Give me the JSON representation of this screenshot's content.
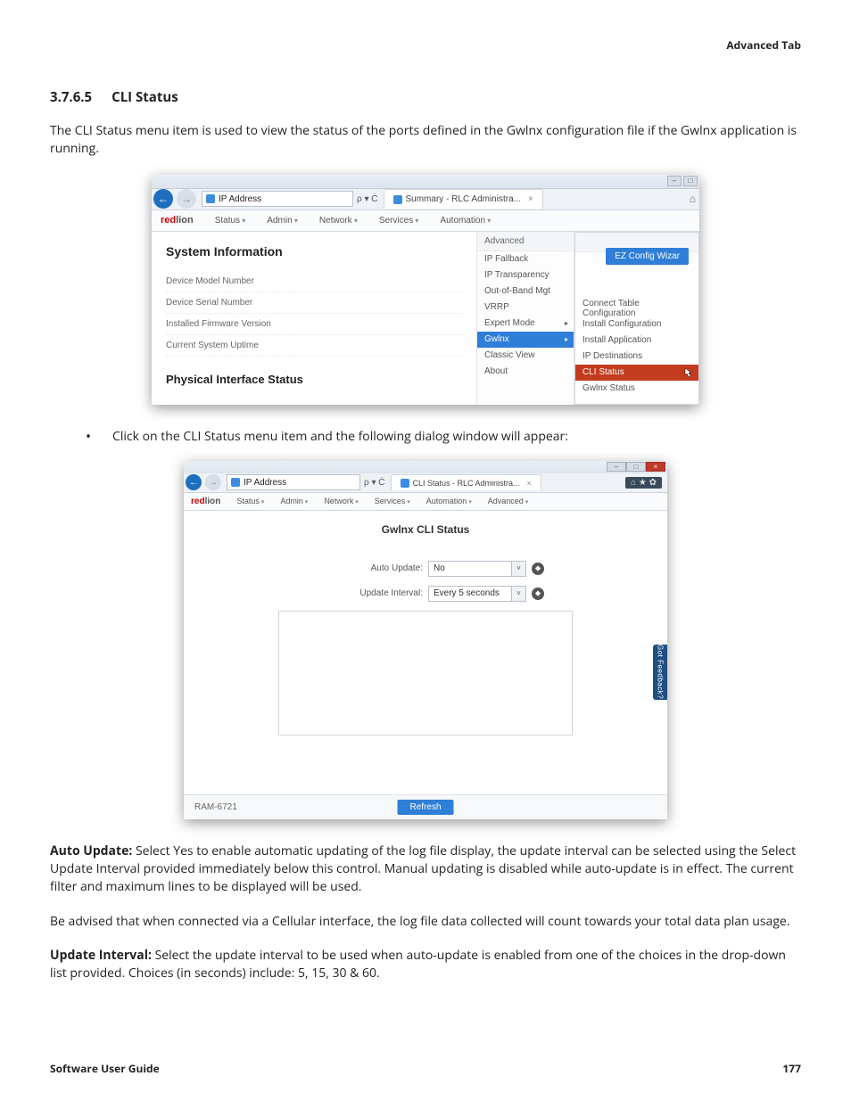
{
  "header": {
    "right": "Advanced Tab"
  },
  "section": {
    "number": "3.7.6.5",
    "title": "CLI Status"
  },
  "intro": "The CLI Status menu item is used to view the status of the ports defined in the Gwlnx configuration file if the Gwlnx application is running.",
  "bullet1": "Click on the CLI Status menu item and the following dialog window will appear:",
  "fig1": {
    "address": "IP Address",
    "searchTools": "ρ ▾ Ċ",
    "tab": "Summary - RLC Administra...",
    "logoA": "red",
    "logoB": "lion",
    "menus": [
      "Status",
      "Admin",
      "Network",
      "Services",
      "Automation"
    ],
    "advanced": "Advanced",
    "sysinfo": "System Information",
    "rows": [
      "Device Model Number",
      "Device Serial Number",
      "Installed Firmware Version",
      "Current System Uptime"
    ],
    "phys": "Physical Interface Status",
    "dd": [
      "IP Fallback",
      "IP Transparency",
      "Out-of-Band Mgt",
      "VRRP",
      "Expert Mode",
      "Gwlnx",
      "Classic View",
      "About"
    ],
    "ez": "EZ Config Wizar",
    "sub": [
      "Connect Table Configuration",
      "Install Configuration",
      "Install Application",
      "IP Destinations",
      "CLI Status",
      "Gwlnx Status"
    ]
  },
  "fig2": {
    "address": "IP Address",
    "searchTools": "ρ ▾ Ċ",
    "tab": "CLI Status - RLC Administra...",
    "logoA": "red",
    "logoB": "lion",
    "menus": [
      "Status",
      "Admin",
      "Network",
      "Services",
      "Automation",
      "Advanced"
    ],
    "title": "Gwlnx CLI Status",
    "autoLabel": "Auto Update:",
    "autoValue": "No",
    "intLabel": "Update Interval:",
    "intValue": "Every 5 seconds",
    "feedback": "Got Feedback?",
    "model": "RAM-6721",
    "refresh": "Refresh",
    "iconsRight": "⌂ ★ ✿"
  },
  "para_auto_label": "Auto Update:",
  "para_auto": " Select Yes to enable automatic updating of the log file display, the update interval can be selected using the Select Update Interval provided immediately below this control. Manual updating is disabled while auto-update is in effect. The current filter and maximum lines to be displayed will be used.",
  "para_cell": "Be advised that when connected via a Cellular interface, the log file data collected will count towards your total data plan usage.",
  "para_int_label": "Update Interval:",
  "para_int": " Select the update interval to be used when auto-update is enabled from one of the choices in the drop-down list provided. Choices (in seconds) include: 5, 15, 30 & 60.",
  "footer": {
    "left": "Software User Guide",
    "right": "177"
  }
}
